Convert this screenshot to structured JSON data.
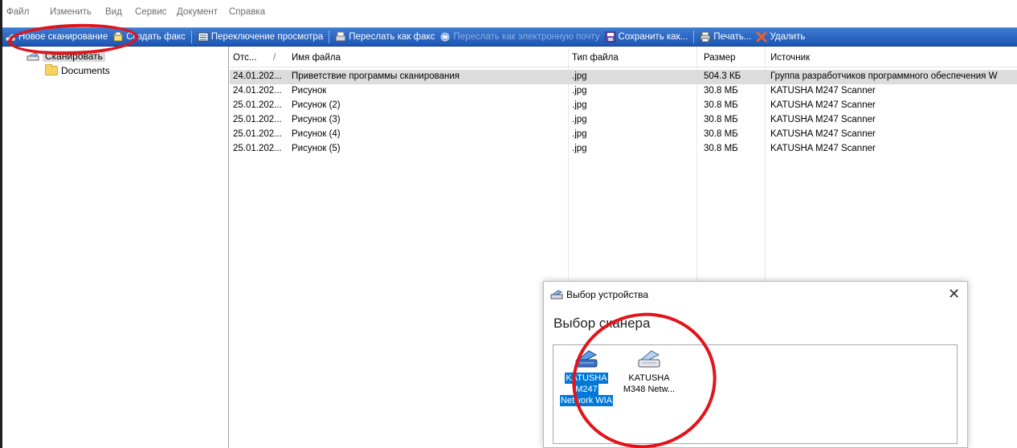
{
  "menu": [
    "Файл",
    "Изменить",
    "Вид",
    "Сервис",
    "Документ",
    "Справка"
  ],
  "toolbar": {
    "new_scan": "Новое сканирование",
    "create_fax": "Создать факс",
    "switch_view": "Переключение просмотра",
    "forward_fax": "Переслать как факс",
    "forward_email": "Переслать как электронную почту",
    "save_as": "Сохранить как...",
    "print": "Печать...",
    "delete": "Удалить"
  },
  "tree": {
    "root": "Сканировать",
    "child": "Documents"
  },
  "list": {
    "columns": [
      "Отс...",
      "/",
      "Имя файла",
      "Тип файла",
      "Размер",
      "Источник"
    ],
    "rows": [
      {
        "date": "24.01.202...",
        "name": "Приветствие программы сканирования",
        "type": ".jpg",
        "size": "504.3 КБ",
        "source": "Группа разработчиков программного обеспечения W"
      },
      {
        "date": "24.01.202...",
        "name": "Рисунок",
        "type": ".jpg",
        "size": "30.8 МБ",
        "source": "KATUSHA M247 Scanner"
      },
      {
        "date": "25.01.202...",
        "name": "Рисунок (2)",
        "type": ".jpg",
        "size": "30.8 МБ",
        "source": "KATUSHA M247 Scanner"
      },
      {
        "date": "25.01.202...",
        "name": "Рисунок (3)",
        "type": ".jpg",
        "size": "30.8 МБ",
        "source": "KATUSHA M247 Scanner"
      },
      {
        "date": "25.01.202...",
        "name": "Рисунок (4)",
        "type": ".jpg",
        "size": "30.8 МБ",
        "source": "KATUSHA M247 Scanner"
      },
      {
        "date": "25.01.202...",
        "name": "Рисунок (5)",
        "type": ".jpg",
        "size": "30.8 МБ",
        "source": "KATUSHA M247 Scanner"
      }
    ]
  },
  "dialog": {
    "title": "Выбор устройства",
    "close": "✕",
    "heading": "Выбор сканера",
    "devices": [
      {
        "line1": "KATUSHA",
        "line2": "M247",
        "line3": "Network WIA",
        "selected": true
      },
      {
        "line1": "KATUSHA",
        "line2": "M348 Netw...",
        "line3": "",
        "selected": false
      }
    ]
  },
  "colors": {
    "toolbar": "#1c56b5",
    "selection": "#0078d7",
    "annotation": "#e0141a"
  }
}
